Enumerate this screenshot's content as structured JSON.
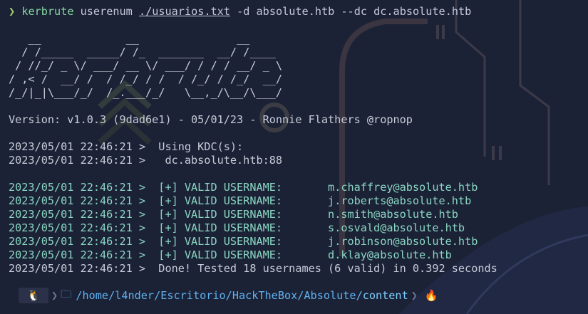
{
  "command": {
    "prompt_symbol": "❯",
    "program": "kerbrute",
    "subcommand": "userenum",
    "file": "./usuarios.txt",
    "args_a": "-d absolute.htb --dc dc.absolute.htb"
  },
  "banner": [
    "   __             __               __     ",
    "  / /_____  _____/ /_  _______  __/ /____ ",
    " / //_/ _ \\/ ___/ __ \\/ ___/ / / / __/ _ \\",
    "/ ,< /  __/ /  / /_/ / /  / /_/ / /_/  __/",
    "/_/|_|\\___/_/  /_.___/_/   \\__,_/\\__/\\___/ "
  ],
  "version": "Version: v1.0.3 (9dad6e1) - 05/01/23 - Ronnie Flathers @ropnop",
  "kdc": [
    "2023/05/01 22:46:21 >  Using KDC(s):",
    "2023/05/01 22:46:21 >   dc.absolute.htb:88"
  ],
  "valid_rows": [
    {
      "prefix": "2023/05/01 22:46:21 >  [+] VALID USERNAME:       ",
      "email": "m.chaffrey@absolute.htb"
    },
    {
      "prefix": "2023/05/01 22:46:21 >  [+] VALID USERNAME:       ",
      "email": "j.roberts@absolute.htb"
    },
    {
      "prefix": "2023/05/01 22:46:21 >  [+] VALID USERNAME:       ",
      "email": "n.smith@absolute.htb"
    },
    {
      "prefix": "2023/05/01 22:46:21 >  [+] VALID USERNAME:       ",
      "email": "s.osvald@absolute.htb"
    },
    {
      "prefix": "2023/05/01 22:46:21 >  [+] VALID USERNAME:       ",
      "email": "j.robinson@absolute.htb"
    },
    {
      "prefix": "2023/05/01 22:46:21 >  [+] VALID USERNAME:       ",
      "email": "d.klay@absolute.htb"
    }
  ],
  "done": "2023/05/01 22:46:21 >  Done! Tested 18 usernames (6 valid) in 0.392 seconds",
  "prompt": {
    "os_icon": "🐧",
    "sep": "❯",
    "folder_icon": "🗀",
    "path_parts": [
      "/home",
      "/l4nder",
      "/Escritorio",
      "/HackTheBox",
      "/Absolute",
      "/"
    ],
    "current": "content",
    "end_icon": "🔥"
  }
}
